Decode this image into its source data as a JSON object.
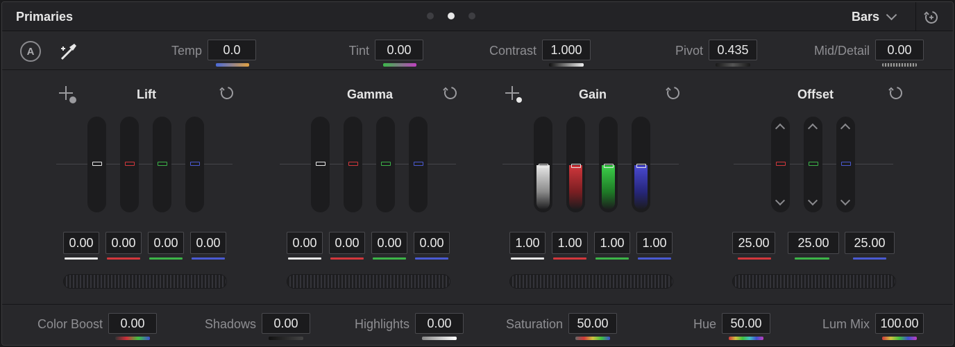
{
  "header": {
    "title": "Primaries",
    "page_dots": 3,
    "active_dot": 1,
    "mode": "Bars"
  },
  "toolbar": {
    "auto_label": "A",
    "params": [
      {
        "label": "Temp",
        "value": "0.0"
      },
      {
        "label": "Tint",
        "value": "0.00"
      },
      {
        "label": "Contrast",
        "value": "1.000"
      },
      {
        "label": "Pivot",
        "value": "0.435"
      },
      {
        "label": "Mid/Detail",
        "value": "0.00"
      }
    ]
  },
  "wheels": [
    {
      "title": "Lift",
      "values": [
        "0.00",
        "0.00",
        "0.00",
        "0.00"
      ],
      "level": 0.5
    },
    {
      "title": "Gamma",
      "values": [
        "0.00",
        "0.00",
        "0.00",
        "0.00"
      ],
      "level": 0.5
    },
    {
      "title": "Gain",
      "values": [
        "1.00",
        "1.00",
        "1.00",
        "1.00"
      ],
      "level": 0.5
    },
    {
      "title": "Offset",
      "values": [
        "25.00",
        "25.00",
        "25.00"
      ],
      "level": 0.5
    }
  ],
  "bottom": {
    "params": [
      {
        "label": "Color Boost",
        "value": "0.00"
      },
      {
        "label": "Shadows",
        "value": "0.00"
      },
      {
        "label": "Highlights",
        "value": "0.00"
      },
      {
        "label": "Saturation",
        "value": "50.00"
      },
      {
        "label": "Hue",
        "value": "50.00"
      },
      {
        "label": "Lum Mix",
        "value": "100.00"
      }
    ]
  },
  "colors": {
    "white": "#e8e8e8",
    "red": "#d2373c",
    "green": "#3cb448",
    "blue": "#4a5ad2"
  }
}
